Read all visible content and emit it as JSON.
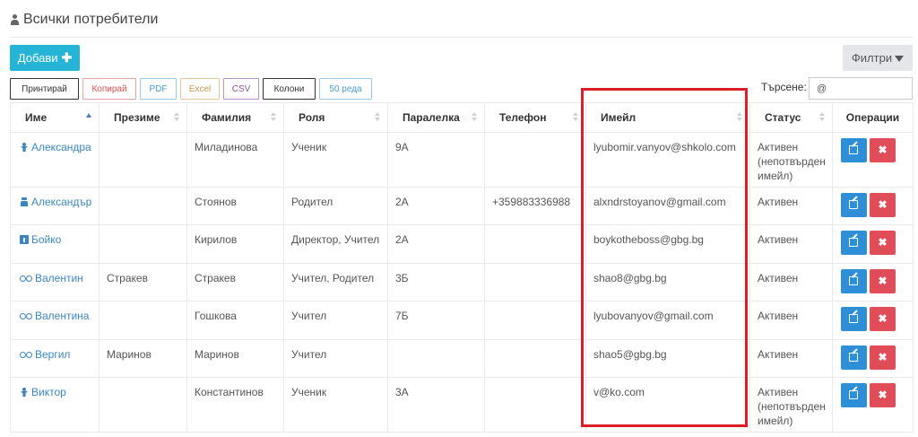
{
  "page": {
    "title": "Всички потребители"
  },
  "toolbar": {
    "add_label": "Добави",
    "filter_label": "Филтри"
  },
  "export_buttons": {
    "print": "Принтирай",
    "copy": "Копирай",
    "pdf": "PDF",
    "excel": "Excel",
    "csv": "CSV",
    "columns": "Колони",
    "rows": "50 реда"
  },
  "search": {
    "label": "Търсене:",
    "value": "@"
  },
  "table": {
    "headers": {
      "name": "Име",
      "middle_name": "Презиме",
      "last_name": "Фамилия",
      "role": "Роля",
      "class": "Паралелка",
      "phone": "Телефон",
      "email": "Имейл",
      "status": "Статус",
      "operations": "Операции"
    },
    "rows": [
      {
        "icon": "student-icon",
        "name": "Александра",
        "middle_name": "",
        "last_name": "Миладинова",
        "role": "Ученик",
        "class": "9А",
        "phone": "",
        "email": "lyubomir.vanyov@shkolo.com",
        "status": "Активен (непотвърден имейл)"
      },
      {
        "icon": "parent-icon",
        "name": "Александър",
        "middle_name": "",
        "last_name": "Стоянов",
        "role": "Родител",
        "class": "2А",
        "phone": "+359883336988",
        "email": "alxndrstoyanov@gmail.com",
        "status": "Активен"
      },
      {
        "icon": "director-icon",
        "name": "Бойко",
        "middle_name": "",
        "last_name": "Кирилов",
        "role": "Директор, Учител",
        "class": "2А",
        "phone": "",
        "email": "boykotheboss@gbg.bg",
        "status": "Активен"
      },
      {
        "icon": "teacher-icon",
        "name": "Валентин",
        "middle_name": "Стракев",
        "last_name": "Стракев",
        "role": "Учител, Родител",
        "class": "3Б",
        "phone": "",
        "email": "shao8@gbg.bg",
        "status": "Активен"
      },
      {
        "icon": "teacher-icon",
        "name": "Валентина",
        "middle_name": "",
        "last_name": "Гошкова",
        "role": "Учител",
        "class": "7Б",
        "phone": "",
        "email": "lyubovanyov@gmail.com",
        "status": "Активен"
      },
      {
        "icon": "teacher-icon",
        "name": "Вергил",
        "middle_name": "Маринов",
        "last_name": "Маринов",
        "role": "Учител",
        "class": "",
        "phone": "",
        "email": "shao5@gbg.bg",
        "status": "Активен"
      },
      {
        "icon": "student-icon",
        "name": "Виктор",
        "middle_name": "",
        "last_name": "Константинов",
        "role": "Ученик",
        "class": "3А",
        "phone": "",
        "email": "v@ko.com",
        "status": "Активен (непотвърден имейл)"
      }
    ]
  },
  "colors": {
    "accent": "#26b4d6",
    "edit": "#2f8fd6",
    "delete": "#e04c58",
    "link": "#3c86bf",
    "highlight": "#dc1f26"
  }
}
